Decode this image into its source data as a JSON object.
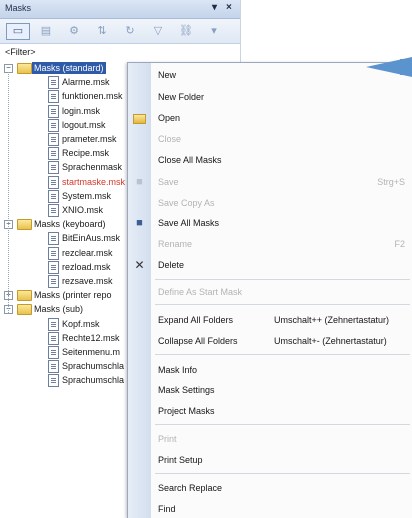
{
  "panel": {
    "title": "Masks",
    "pin": "▾",
    "close": "×",
    "filter": "<Filter>"
  },
  "tree": [
    {
      "label": "Masks (standard)",
      "type": "folder",
      "expanded": true,
      "selected": true
    },
    {
      "label": "Alarme.msk",
      "type": "file"
    },
    {
      "label": "funktionen.msk",
      "type": "file"
    },
    {
      "label": "login.msk",
      "type": "file"
    },
    {
      "label": "logout.msk",
      "type": "file"
    },
    {
      "label": "prameter.msk",
      "type": "file"
    },
    {
      "label": "Recipe.msk",
      "type": "file"
    },
    {
      "label": "Sprachenmask",
      "type": "file"
    },
    {
      "label": "startmaske.msk",
      "type": "file",
      "highlight": "#d4372a"
    },
    {
      "label": "System.msk",
      "type": "file"
    },
    {
      "label": "XNIO.msk",
      "type": "file"
    },
    {
      "label": "Masks (keyboard)",
      "type": "folder",
      "expanded": true
    },
    {
      "label": "BitEinAus.msk",
      "type": "file"
    },
    {
      "label": "rezclear.msk",
      "type": "file"
    },
    {
      "label": "rezload.msk",
      "type": "file"
    },
    {
      "label": "rezsave.msk",
      "type": "file"
    },
    {
      "label": "Masks (printer repo",
      "type": "folder",
      "expanded": false
    },
    {
      "label": "Masks (sub)",
      "type": "folder",
      "expanded": true
    },
    {
      "label": "Kopf.msk",
      "type": "file"
    },
    {
      "label": "Rechte12.msk",
      "type": "file"
    },
    {
      "label": "Seitenmenu.m",
      "type": "file"
    },
    {
      "label": "Sprachumschla",
      "type": "file"
    },
    {
      "label": "Sprachumschla",
      "type": "file"
    }
  ],
  "menu": {
    "new": {
      "label": "New",
      "shortcut": ""
    },
    "new_folder": {
      "label": "New Folder"
    },
    "open": {
      "label": "Open"
    },
    "close": {
      "label": "Close"
    },
    "close_all": {
      "label": "Close All Masks"
    },
    "save": {
      "label": "Save",
      "shortcut": "Strg+S"
    },
    "save_copy": {
      "label": "Save Copy As"
    },
    "save_all": {
      "label": "Save All Masks"
    },
    "rename": {
      "label": "Rename",
      "shortcut": "F2"
    },
    "delete": {
      "label": "Delete"
    },
    "define_start": {
      "label": "Define As Start Mask"
    },
    "expand_all": {
      "label": "Expand All Folders",
      "shortcut": "Umschalt++ (Zehnertastatur)"
    },
    "collapse_all": {
      "label": "Collapse All Folders",
      "shortcut": "Umschalt+- (Zehnertastatur)"
    },
    "mask_info": {
      "label": "Mask Info"
    },
    "mask_settings": {
      "label": "Mask Settings"
    },
    "project_masks": {
      "label": "Project Masks"
    },
    "print": {
      "label": "Print"
    },
    "print_setup": {
      "label": "Print Setup"
    },
    "search_replace": {
      "label": "Search Replace"
    },
    "find": {
      "label": "Find"
    }
  },
  "colors": {
    "selection": "#2f5aa8",
    "callout": "#5b93cf",
    "menu_gutter": "#dbe4f1"
  }
}
